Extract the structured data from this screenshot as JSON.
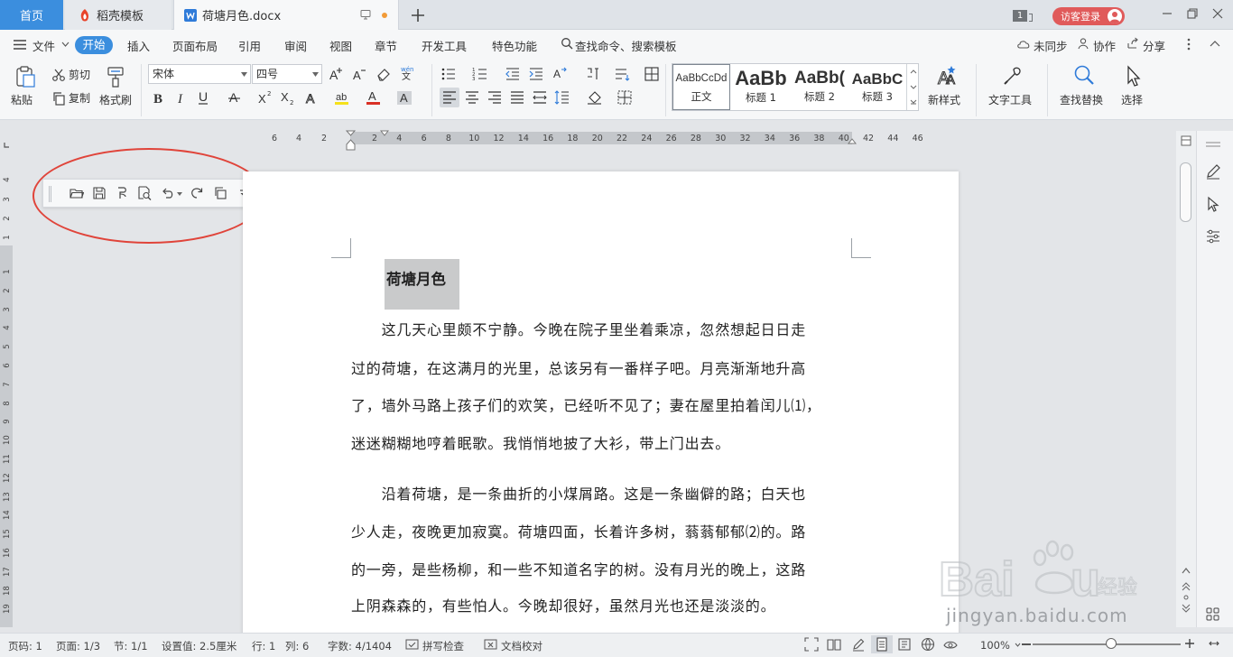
{
  "tabs": {
    "home": "首页",
    "templates": "稻壳模板",
    "document": "荷塘月色.docx"
  },
  "window": {
    "count_badge": "1",
    "login_label": "访客登录"
  },
  "menu": {
    "file": "文件",
    "start": "开始",
    "insert": "插入",
    "layout": "页面布局",
    "references": "引用",
    "review": "审阅",
    "view": "视图",
    "chapter": "章节",
    "developer": "开发工具",
    "features": "特色功能",
    "search": "查找命令、搜索模板",
    "sync": "未同步",
    "collab": "协作",
    "share": "分享"
  },
  "ribbon": {
    "paste": "粘贴",
    "cut": "剪切",
    "copy": "复制",
    "format_painter": "格式刷",
    "font_name": "宋体",
    "font_size": "四号",
    "styles": [
      {
        "preview": "AaBbCcDd",
        "label": "正文"
      },
      {
        "preview": "AaBb",
        "label": "标题 1"
      },
      {
        "preview": "AaBb(",
        "label": "标题 2"
      },
      {
        "preview": "AaBbC",
        "label": "标题 3"
      }
    ],
    "new_style": "新样式",
    "text_tools": "文字工具",
    "find_replace": "查找替换",
    "select": "选择"
  },
  "ruler": {
    "h_left": [
      "6",
      "4",
      "2"
    ],
    "h_right": [
      "2",
      "4",
      "6",
      "8",
      "10",
      "12",
      "14",
      "16",
      "18",
      "20",
      "22",
      "24",
      "26",
      "28",
      "30",
      "32",
      "34",
      "36",
      "38",
      "40",
      "42",
      "44",
      "46"
    ],
    "v_top": [
      "4",
      "3",
      "2",
      "1"
    ],
    "v_main": [
      "1",
      "2",
      "3",
      "4",
      "5",
      "6",
      "7",
      "8",
      "9",
      "10",
      "11",
      "12",
      "13",
      "14",
      "15",
      "16",
      "17",
      "18",
      "19"
    ]
  },
  "document": {
    "title": "荷塘月色",
    "lines": [
      "　　这几天心里颇不宁静。今晚在院子里坐着乘凉，忽然想起日日走",
      "过的荷塘，在这满月的光里，总该另有一番样子吧。月亮渐渐地升高",
      "了，墙外马路上孩子们的欢笑，已经听不见了；妻在屋里拍着闰儿⑴，",
      "迷迷糊糊地哼着眠歌。我悄悄地披了大衫，带上门出去。",
      "　　沿着荷塘，是一条曲折的小煤屑路。这是一条幽僻的路；白天也",
      "少人走，夜晚更加寂寞。荷塘四面，长着许多树，蓊蓊郁郁⑵的。路",
      "的一旁，是些杨柳，和一些不知道名字的树。没有月光的晚上，这路",
      "上阴森森的，有些怕人。今晚却很好，虽然月光也还是淡淡的。"
    ]
  },
  "status": {
    "page_num": "页码: 1",
    "page_count": "页面: 1/3",
    "section": "节: 1/1",
    "setting": "设置值: 2.5厘米",
    "row": "行: 1",
    "col": "列: 6",
    "words": "字数: 4/1404",
    "spell": "拼写检查",
    "proof": "文档校对",
    "zoom": "100%"
  },
  "watermark": {
    "url": "jingyan.baidu.com"
  },
  "colors": {
    "accent": "#3b8ede",
    "login": "#e05a5a",
    "highlight_circle": "#e0443a"
  }
}
